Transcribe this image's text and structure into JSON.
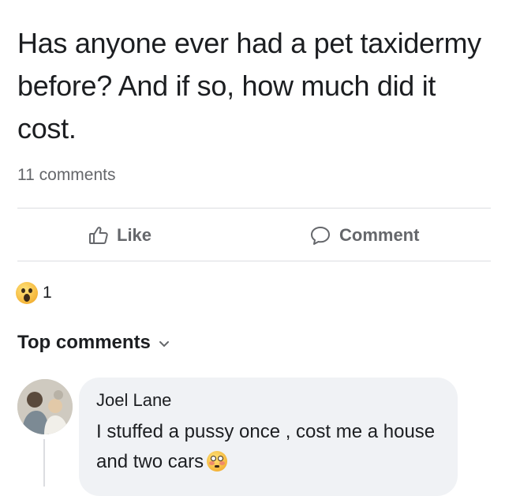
{
  "post": {
    "text": "Has anyone ever had a pet taxidermy before? And if so, how much did it cost.",
    "comment_count": "11 comments"
  },
  "actions": {
    "like_label": "Like",
    "comment_label": "Comment"
  },
  "reactions": {
    "icon": "wow-emoji-icon",
    "count": "1"
  },
  "comments_section": {
    "sort_label": "Top comments",
    "sort_icon": "chevron-down-icon"
  },
  "comment": {
    "author": "Joel Lane",
    "text": "I stuffed a pussy once , cost me a house and two cars",
    "trailing_emoji": "flushed-emoji-icon"
  },
  "colors": {
    "text_primary": "#1c1e21",
    "text_secondary": "#65676b",
    "bubble_bg": "#f0f2f5",
    "divider": "#dcdde1"
  }
}
